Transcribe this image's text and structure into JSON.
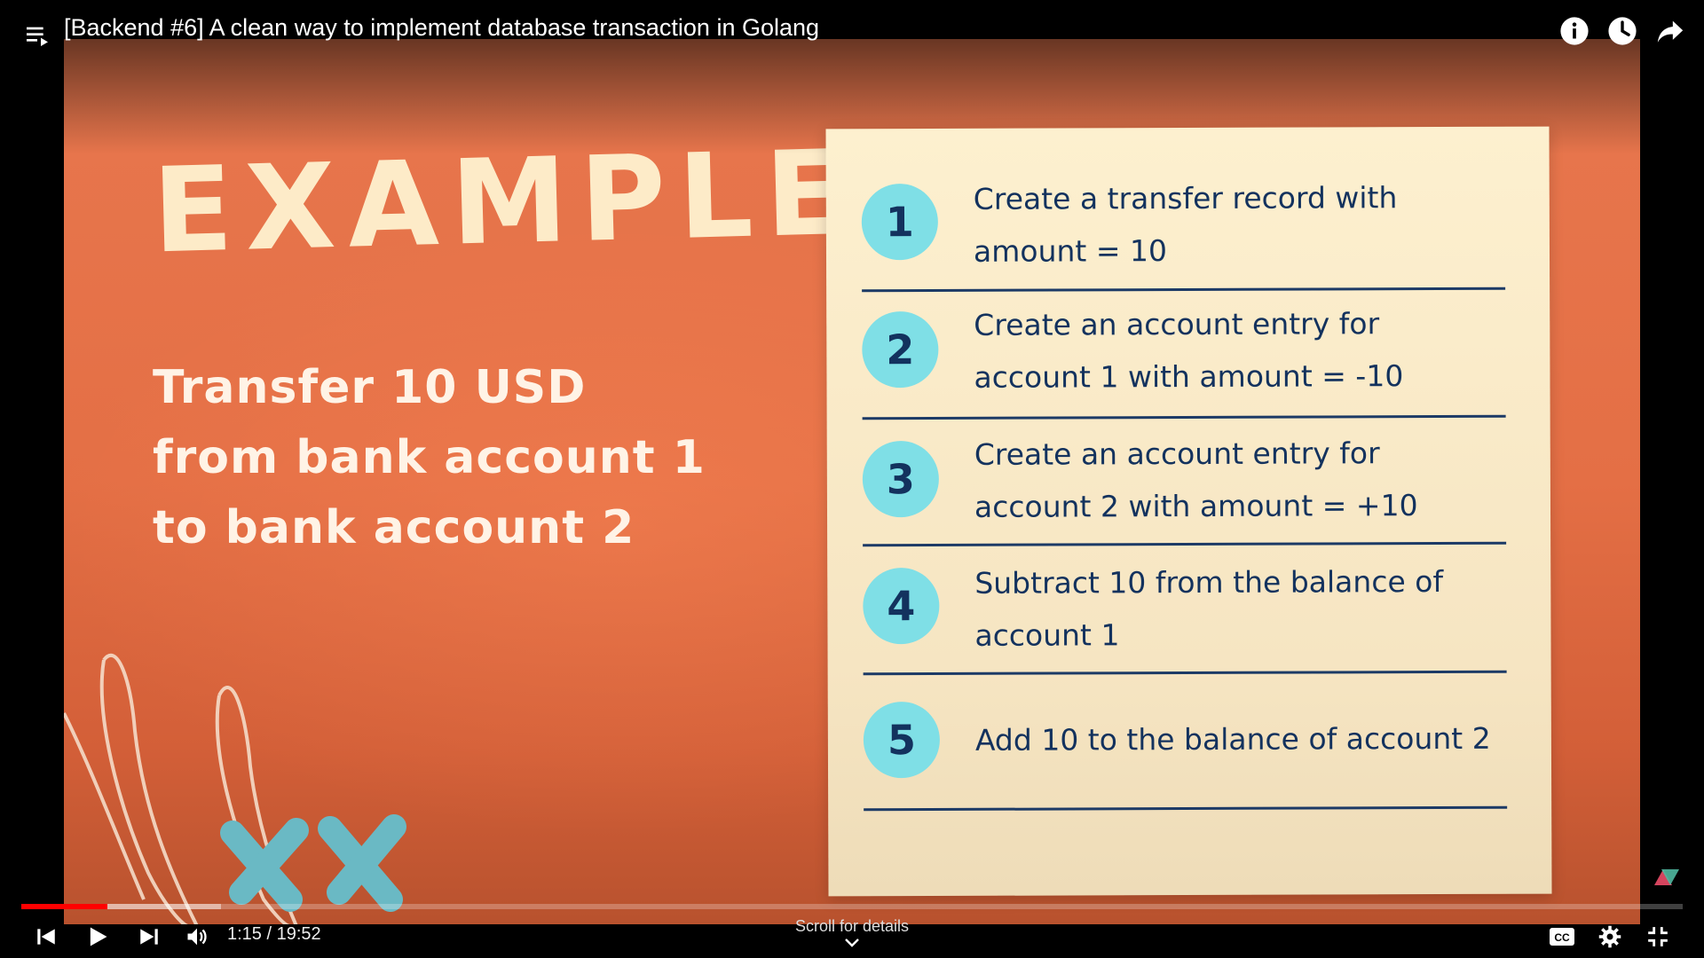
{
  "player": {
    "title": "[Backend #6] A clean way to implement database transaction in Golang",
    "time_display": "1:15 / 19:52",
    "progress_fraction": 0.052,
    "buffered_fraction": 0.12,
    "scroll_hint": "Scroll for details"
  },
  "slide": {
    "heading": "EXAMPLE",
    "subtitle_lines": [
      "Transfer 10 USD",
      "from bank account 1",
      "to bank account 2"
    ],
    "steps": [
      {
        "number": "1",
        "line1": "Create a transfer record with",
        "line2": "amount = 10"
      },
      {
        "number": "2",
        "line1": "Create an account entry for",
        "line2": "account 1 with amount = -10"
      },
      {
        "number": "3",
        "line1": "Create an account entry for",
        "line2": "account 2 with amount = +10"
      },
      {
        "number": "4",
        "line1": "Subtract 10 from the balance of",
        "line2": "account 1"
      },
      {
        "number": "5",
        "line1": "Add 10 to the balance of account 2",
        "line2": ""
      }
    ]
  },
  "icons": {
    "playlist": "playlist-icon",
    "info": "info-icon",
    "watch_later": "clock-icon",
    "share": "share-arrow-icon",
    "previous": "skip-previous-icon",
    "play": "play-icon",
    "next": "skip-next-icon",
    "volume": "volume-icon",
    "captions": "cc-icon",
    "settings": "gear-icon",
    "fullscreen_exit": "exit-fullscreen-icon"
  },
  "colors": {
    "slide_background": "#e4704a",
    "heading": "#fdebc8",
    "card": "#fdf0cf",
    "step_circle": "#7fdfe6",
    "step_text": "#13325e",
    "progress_played": "#ff0000"
  }
}
